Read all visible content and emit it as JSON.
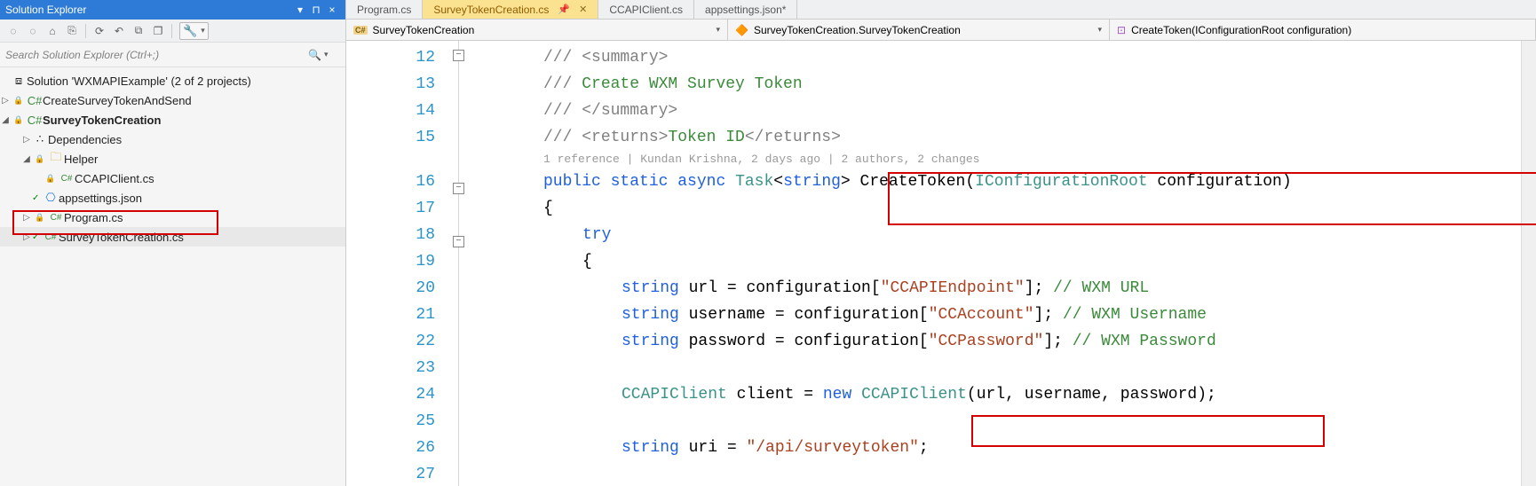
{
  "se": {
    "title": "Solution Explorer",
    "search_placeholder": "Search Solution Explorer (Ctrl+;)",
    "solution": "Solution 'WXMAPIExample' (2 of 2 projects)",
    "proj1": "CreateSurveyTokenAndSend",
    "proj2": "SurveyTokenCreation",
    "deps": "Dependencies",
    "helper": "Helper",
    "ccapi": "CCAPIClient.cs",
    "appsettings": "appsettings.json",
    "program": "Program.cs",
    "stc": "SurveyTokenCreation.cs"
  },
  "tabs": {
    "t1": "Program.cs",
    "t2": "SurveyTokenCreation.cs",
    "t3": "CCAPIClient.cs",
    "t4": "appsettings.json*"
  },
  "nav": {
    "ns": "SurveyTokenCreation",
    "cls": "SurveyTokenCreation.SurveyTokenCreation",
    "meth": "CreateToken(IConfigurationRoot configuration)"
  },
  "lines": {
    "l12": "12",
    "l13": "13",
    "l14": "14",
    "l15": "15",
    "l16": "16",
    "l17": "17",
    "l18": "18",
    "l19": "19",
    "l20": "20",
    "l21": "21",
    "l22": "22",
    "l23": "23",
    "l24": "24",
    "l25": "25",
    "l26": "26",
    "l27": "27"
  },
  "code": {
    "slash": "///",
    "sum_open": "<summary>",
    "sum_text": "Create WXM Survey Token",
    "sum_close": "</summary>",
    "ret_open": "<returns>",
    "ret_text": "Token ID",
    "ret_close": "</returns>",
    "codelens": "1 reference | Kundan Krishna, 2 days ago | 2 authors, 2 changes",
    "kw_public": "public",
    "kw_static": "static",
    "kw_async": "async",
    "kw_task": "Task",
    "kw_string": "string",
    "kw_try": "try",
    "kw_new": "new",
    "m_create": "CreateToken",
    "t_icroot": "IConfigurationRoot",
    "p_config": "configuration",
    "v_url": "url",
    "v_username": "username",
    "v_password": "password",
    "v_client": "client",
    "v_uri": "uri",
    "t_ccapi": "CCAPIClient",
    "s_endp": "\"CCAPIEndpoint\"",
    "s_acct": "\"CCAccount\"",
    "s_pass": "\"CCPassword\"",
    "s_uri": "\"/api/surveytoken\"",
    "c_url": "// WXM URL",
    "c_user": "// WXM Username",
    "c_pass": "// WXM Password"
  }
}
